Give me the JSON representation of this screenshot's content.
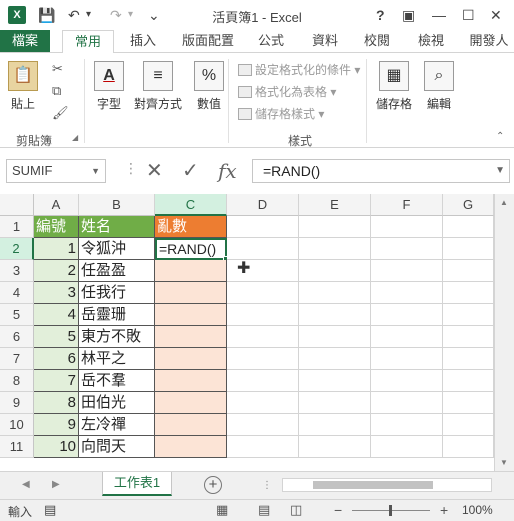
{
  "app": {
    "logo": "X",
    "title": "活頁簿1 - Excel",
    "window_buttons": {
      "help": "?",
      "ribbon_options": "▣",
      "minimize": "—",
      "restore": "☐",
      "close": "✕"
    },
    "qat": {
      "save": "💾",
      "undo": "↶",
      "redo": "↷",
      "customize": "⌄"
    }
  },
  "ribbon": {
    "tabs": [
      "檔案",
      "常用",
      "插入",
      "版面配置",
      "公式",
      "資料",
      "校閱",
      "檢視",
      "開發人"
    ],
    "active_tab": "常用",
    "groups": {
      "clipboard": {
        "paste": "貼上",
        "label": "剪貼簿"
      },
      "font": {
        "label": "字型"
      },
      "alignment": {
        "label": "對齊方式"
      },
      "number": {
        "label": "數值"
      },
      "styles": {
        "conditional": "設定格式化的條件",
        "as_table": "格式化為表格",
        "cell_styles": "儲存格樣式",
        "label": "樣式"
      },
      "cells": {
        "label": "儲存格"
      },
      "editing": {
        "label": "編輯"
      }
    }
  },
  "formula_bar": {
    "name_box": "SUMIF",
    "cancel": "✕",
    "enter": "✓",
    "fx": "fx",
    "value": "=RAND()"
  },
  "grid": {
    "columns": [
      "A",
      "B",
      "C",
      "D",
      "E",
      "F",
      "G"
    ],
    "rows": [
      "1",
      "2",
      "3",
      "4",
      "5",
      "6",
      "7",
      "8",
      "9",
      "10",
      "11"
    ],
    "headers": {
      "a": "編號",
      "b": "姓名",
      "c": "亂數"
    },
    "data": [
      {
        "no": "1",
        "name": "令狐沖",
        "rand": "=RAND()"
      },
      {
        "no": "2",
        "name": "任盈盈",
        "rand": ""
      },
      {
        "no": "3",
        "name": "任我行",
        "rand": ""
      },
      {
        "no": "4",
        "name": "岳靈珊",
        "rand": ""
      },
      {
        "no": "5",
        "name": "東方不敗",
        "rand": ""
      },
      {
        "no": "6",
        "name": "林平之",
        "rand": ""
      },
      {
        "no": "7",
        "name": "岳不羣",
        "rand": ""
      },
      {
        "no": "8",
        "name": "田伯光",
        "rand": ""
      },
      {
        "no": "9",
        "name": "左冷禪",
        "rand": ""
      },
      {
        "no": "10",
        "name": "向問天",
        "rand": ""
      }
    ],
    "active_cell": "C2"
  },
  "sheets": {
    "tabs": [
      "工作表1"
    ],
    "add": "+",
    "nav_prev": "◀",
    "nav_next": "▶",
    "more": "⋮"
  },
  "status": {
    "mode": "輸入",
    "zoom": "100%",
    "zoom_out": "−",
    "zoom_in": "+"
  },
  "colors": {
    "accent": "#217346",
    "header_green": "#70ad47",
    "header_orange": "#ed7d31",
    "num_fill": "#e2efda",
    "rand_fill": "#fce4d6"
  }
}
